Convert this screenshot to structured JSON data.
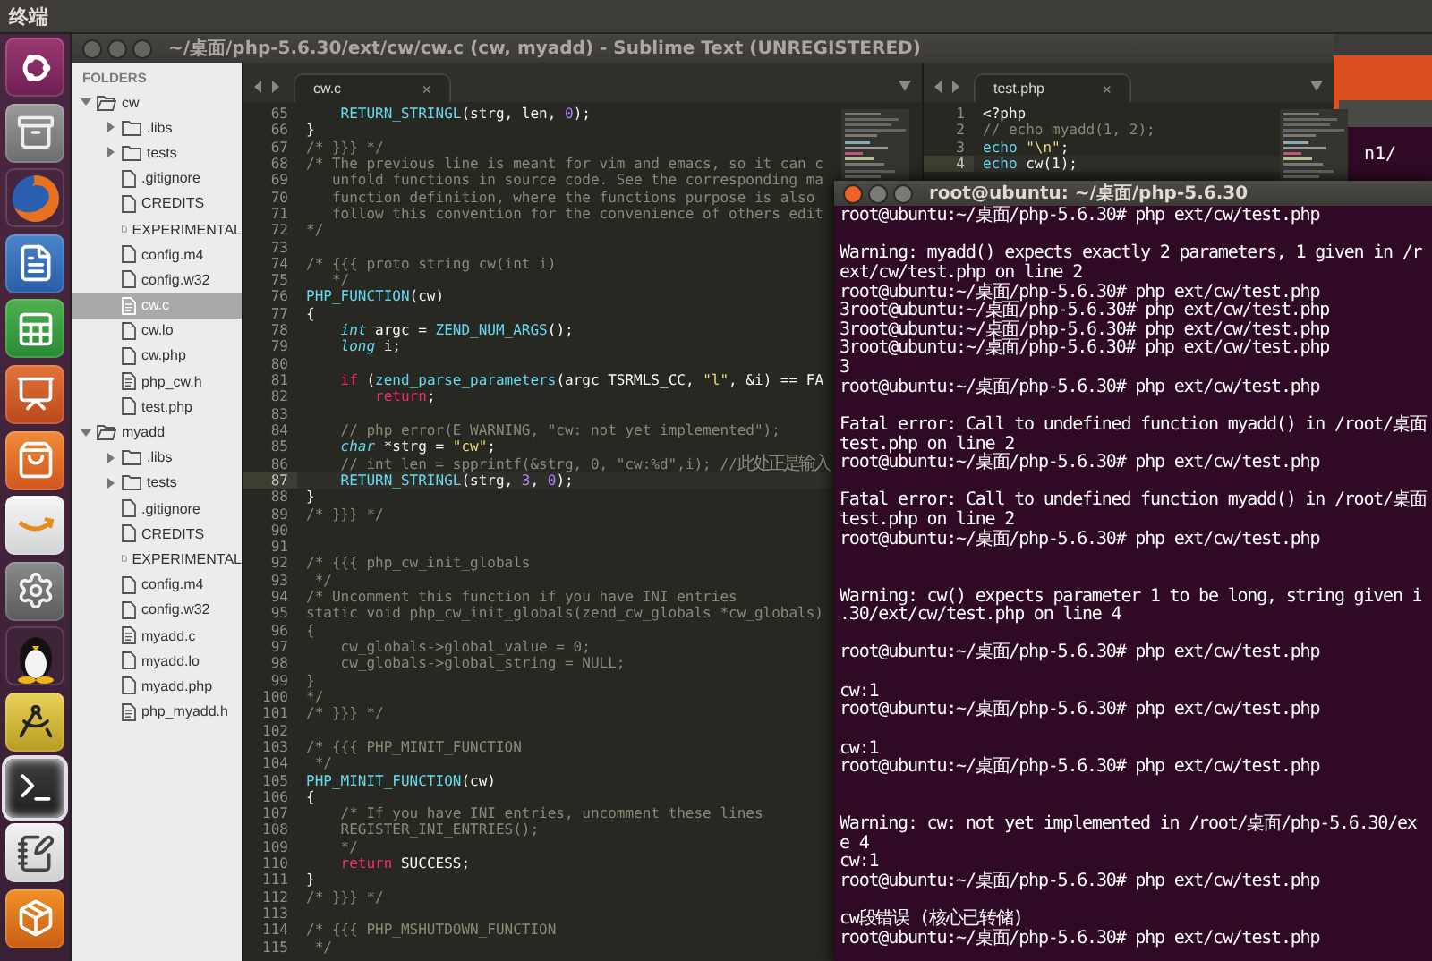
{
  "top_bar": {
    "title": "终端"
  },
  "launcher": {
    "items": [
      {
        "kind": "dash",
        "selected": false
      },
      {
        "kind": "files",
        "selected": false
      },
      {
        "kind": "browser",
        "selected": false
      },
      {
        "kind": "writer",
        "selected": false
      },
      {
        "kind": "calc",
        "selected": false
      },
      {
        "kind": "impress",
        "selected": false
      },
      {
        "kind": "store",
        "selected": false
      },
      {
        "kind": "amazon",
        "selected": false
      },
      {
        "kind": "settings",
        "selected": false
      },
      {
        "kind": "penguin",
        "selected": false
      },
      {
        "kind": "geometry",
        "selected": false
      },
      {
        "kind": "terminal",
        "selected": true
      },
      {
        "kind": "editor",
        "selected": false
      },
      {
        "kind": "box",
        "selected": false
      }
    ]
  },
  "editor": {
    "title": "~/桌面/php-5.6.30/ext/cw/cw.c (cw, myadd) - Sublime Text (UNREGISTERED)",
    "sidebar": {
      "heading": "FOLDERS",
      "tree": [
        {
          "label": "cw",
          "kind": "folder",
          "expanded": true,
          "selected": false,
          "children": [
            {
              "label": ".libs",
              "kind": "folder",
              "expanded": false,
              "selected": false
            },
            {
              "label": "tests",
              "kind": "folder",
              "expanded": false,
              "selected": false
            },
            {
              "label": ".gitignore",
              "kind": "file",
              "selected": false
            },
            {
              "label": "CREDITS",
              "kind": "file",
              "selected": false
            },
            {
              "label": "EXPERIMENTAL",
              "kind": "file",
              "selected": false
            },
            {
              "label": "config.m4",
              "kind": "file",
              "selected": false
            },
            {
              "label": "config.w32",
              "kind": "file",
              "selected": false
            },
            {
              "label": "cw.c",
              "kind": "source",
              "selected": true
            },
            {
              "label": "cw.lo",
              "kind": "file",
              "selected": false
            },
            {
              "label": "cw.php",
              "kind": "file",
              "selected": false
            },
            {
              "label": "php_cw.h",
              "kind": "source",
              "selected": false
            },
            {
              "label": "test.php",
              "kind": "file",
              "selected": false
            }
          ]
        },
        {
          "label": "myadd",
          "kind": "folder",
          "expanded": true,
          "selected": false,
          "children": [
            {
              "label": ".libs",
              "kind": "folder",
              "expanded": false,
              "selected": false
            },
            {
              "label": "tests",
              "kind": "folder",
              "expanded": false,
              "selected": false
            },
            {
              "label": ".gitignore",
              "kind": "file",
              "selected": false
            },
            {
              "label": "CREDITS",
              "kind": "file",
              "selected": false
            },
            {
              "label": "EXPERIMENTAL",
              "kind": "file",
              "selected": false
            },
            {
              "label": "config.m4",
              "kind": "file",
              "selected": false
            },
            {
              "label": "config.w32",
              "kind": "file",
              "selected": false
            },
            {
              "label": "myadd.c",
              "kind": "source",
              "selected": false
            },
            {
              "label": "myadd.lo",
              "kind": "file",
              "selected": false
            },
            {
              "label": "myadd.php",
              "kind": "file",
              "selected": false
            },
            {
              "label": "php_myadd.h",
              "kind": "source",
              "selected": false
            }
          ]
        }
      ]
    },
    "panes": [
      {
        "tabs": [
          {
            "label": "cw.c",
            "close": "×",
            "selected": true
          }
        ],
        "lines": [
          {
            "number": "65",
            "current": false,
            "tokens": [
              {
                "kind": "func",
                "text": "    RETURN_STRINGL"
              },
              {
                "kind": "plain",
                "text": "(strg, len, "
              },
              {
                "kind": "number",
                "text": "0"
              },
              {
                "kind": "plain",
                "text": ");"
              }
            ]
          },
          {
            "number": "66",
            "current": false,
            "tokens": [
              {
                "kind": "plain",
                "text": "}"
              }
            ]
          },
          {
            "number": "67",
            "current": false,
            "tokens": [
              {
                "kind": "comment",
                "text": "/* }}} */"
              }
            ]
          },
          {
            "number": "68",
            "current": false,
            "tokens": [
              {
                "kind": "comment",
                "text": "/* The previous line is meant for vim and emacs, so it can c"
              }
            ]
          },
          {
            "number": "69",
            "current": false,
            "tokens": [
              {
                "kind": "comment",
                "text": "   unfold functions in source code. See the corresponding ma"
              }
            ]
          },
          {
            "number": "70",
            "current": false,
            "tokens": [
              {
                "kind": "comment",
                "text": "   function definition, where the functions purpose is also"
              }
            ]
          },
          {
            "number": "71",
            "current": false,
            "tokens": [
              {
                "kind": "comment",
                "text": "   follow this convention for the convenience of others edit"
              }
            ]
          },
          {
            "number": "72",
            "current": false,
            "tokens": [
              {
                "kind": "comment",
                "text": "*/"
              }
            ]
          },
          {
            "number": "73",
            "current": false
          },
          {
            "number": "74",
            "current": false,
            "tokens": [
              {
                "kind": "comment",
                "text": "/* {{{ proto string cw(int i)"
              }
            ]
          },
          {
            "number": "75",
            "current": false,
            "tokens": [
              {
                "kind": "comment",
                "text": "   */"
              }
            ]
          },
          {
            "number": "76",
            "current": false,
            "tokens": [
              {
                "kind": "func",
                "text": "PHP_FUNCTION"
              },
              {
                "kind": "plain",
                "text": "(cw)"
              }
            ]
          },
          {
            "number": "77",
            "current": false,
            "tokens": [
              {
                "kind": "plain",
                "text": "{"
              }
            ]
          },
          {
            "number": "78",
            "current": false,
            "tokens": [
              {
                "kind": "type",
                "text": "    int"
              },
              {
                "kind": "plain",
                "text": " argc = "
              },
              {
                "kind": "func",
                "text": "ZEND_NUM_ARGS"
              },
              {
                "kind": "plain",
                "text": "();"
              }
            ]
          },
          {
            "number": "79",
            "current": false,
            "tokens": [
              {
                "kind": "type",
                "text": "    long"
              },
              {
                "kind": "plain",
                "text": " i;"
              }
            ]
          },
          {
            "number": "80",
            "current": false
          },
          {
            "number": "81",
            "current": false,
            "tokens": [
              {
                "kind": "keyword",
                "text": "    if"
              },
              {
                "kind": "plain",
                "text": " ("
              },
              {
                "kind": "func",
                "text": "zend_parse_parameters"
              },
              {
                "kind": "plain",
                "text": "(argc TSRMLS_CC, "
              },
              {
                "kind": "string",
                "text": "\"l\""
              },
              {
                "kind": "plain",
                "text": ", &i) == FA"
              }
            ]
          },
          {
            "number": "82",
            "current": false,
            "tokens": [
              {
                "kind": "keyword",
                "text": "        return"
              },
              {
                "kind": "plain",
                "text": ";"
              }
            ]
          },
          {
            "number": "83",
            "current": false
          },
          {
            "number": "84",
            "current": false,
            "tokens": [
              {
                "kind": "comment",
                "text": "    // php_error(E_WARNING, \"cw: not yet implemented\");"
              }
            ]
          },
          {
            "number": "85",
            "current": false,
            "tokens": [
              {
                "kind": "type",
                "text": "    char"
              },
              {
                "kind": "plain",
                "text": " *strg = "
              },
              {
                "kind": "string",
                "text": "\"cw\""
              },
              {
                "kind": "plain",
                "text": ";"
              }
            ]
          },
          {
            "number": "86",
            "current": false,
            "tokens": [
              {
                "kind": "comment",
                "text": "    // int len = spprintf(&strg, 0, \"cw:%d\",i); //"
              },
              {
                "kind": "wide",
                "text": "此处正是输入"
              }
            ]
          },
          {
            "number": "87",
            "current": true,
            "tokens": [
              {
                "kind": "func",
                "text": "    RETURN_STRINGL"
              },
              {
                "kind": "plain",
                "text": "(strg, "
              },
              {
                "kind": "number",
                "text": "3"
              },
              {
                "kind": "plain",
                "text": ", "
              },
              {
                "kind": "number",
                "text": "0"
              },
              {
                "kind": "plain",
                "text": ");"
              }
            ]
          },
          {
            "number": "88",
            "current": false,
            "tokens": [
              {
                "kind": "plain",
                "text": "}"
              }
            ]
          },
          {
            "number": "89",
            "current": false,
            "tokens": [
              {
                "kind": "comment",
                "text": "/* }}} */"
              }
            ]
          },
          {
            "number": "90",
            "current": false
          },
          {
            "number": "91",
            "current": false
          },
          {
            "number": "92",
            "current": false,
            "tokens": [
              {
                "kind": "comment",
                "text": "/* {{{ php_cw_init_globals"
              }
            ]
          },
          {
            "number": "93",
            "current": false,
            "tokens": [
              {
                "kind": "comment",
                "text": " */"
              }
            ]
          },
          {
            "number": "94",
            "current": false,
            "tokens": [
              {
                "kind": "comment",
                "text": "/* Uncomment this function if you have INI entries"
              }
            ]
          },
          {
            "number": "95",
            "current": false,
            "tokens": [
              {
                "kind": "comment",
                "text": "static void php_cw_init_globals(zend_cw_globals *cw_globals)"
              }
            ]
          },
          {
            "number": "96",
            "current": false,
            "tokens": [
              {
                "kind": "comment",
                "text": "{"
              }
            ]
          },
          {
            "number": "97",
            "current": false,
            "tokens": [
              {
                "kind": "comment",
                "text": "    cw_globals->global_value = 0;"
              }
            ]
          },
          {
            "number": "98",
            "current": false,
            "tokens": [
              {
                "kind": "comment",
                "text": "    cw_globals->global_string = NULL;"
              }
            ]
          },
          {
            "number": "99",
            "current": false,
            "tokens": [
              {
                "kind": "comment",
                "text": "}"
              }
            ]
          },
          {
            "number": "100",
            "current": false,
            "tokens": [
              {
                "kind": "comment",
                "text": "*/"
              }
            ]
          },
          {
            "number": "101",
            "current": false,
            "tokens": [
              {
                "kind": "comment",
                "text": "/* }}} */"
              }
            ]
          },
          {
            "number": "102",
            "current": false
          },
          {
            "number": "103",
            "current": false,
            "tokens": [
              {
                "kind": "comment",
                "text": "/* {{{ PHP_MINIT_FUNCTION"
              }
            ]
          },
          {
            "number": "104",
            "current": false,
            "tokens": [
              {
                "kind": "comment",
                "text": " */"
              }
            ]
          },
          {
            "number": "105",
            "current": false,
            "tokens": [
              {
                "kind": "func",
                "text": "PHP_MINIT_FUNCTION"
              },
              {
                "kind": "plain",
                "text": "(cw)"
              }
            ]
          },
          {
            "number": "106",
            "current": false,
            "tokens": [
              {
                "kind": "plain",
                "text": "{"
              }
            ]
          },
          {
            "number": "107",
            "current": false,
            "tokens": [
              {
                "kind": "comment",
                "text": "    /* If you have INI entries, uncomment these lines"
              }
            ]
          },
          {
            "number": "108",
            "current": false,
            "tokens": [
              {
                "kind": "comment",
                "text": "    REGISTER_INI_ENTRIES();"
              }
            ]
          },
          {
            "number": "109",
            "current": false,
            "tokens": [
              {
                "kind": "comment",
                "text": "    */"
              }
            ]
          },
          {
            "number": "110",
            "current": false,
            "tokens": [
              {
                "kind": "keyword",
                "text": "    return"
              },
              {
                "kind": "plain",
                "text": " SUCCESS;"
              }
            ]
          },
          {
            "number": "111",
            "current": false,
            "tokens": [
              {
                "kind": "plain",
                "text": "}"
              }
            ]
          },
          {
            "number": "112",
            "current": false,
            "tokens": [
              {
                "kind": "comment",
                "text": "/* }}} */"
              }
            ]
          },
          {
            "number": "113",
            "current": false
          },
          {
            "number": "114",
            "current": false,
            "tokens": [
              {
                "kind": "comment",
                "text": "/* {{{ PHP_MSHUTDOWN_FUNCTION"
              }
            ]
          },
          {
            "number": "115",
            "current": false,
            "tokens": [
              {
                "kind": "comment",
                "text": " */"
              }
            ]
          }
        ]
      },
      {
        "tabs": [
          {
            "label": "test.php",
            "close": "×",
            "selected": true
          }
        ],
        "lines": [
          {
            "number": "1",
            "current": false,
            "tokens": [
              {
                "kind": "plain",
                "text": "<?php"
              }
            ]
          },
          {
            "number": "2",
            "current": false,
            "tokens": [
              {
                "kind": "comment",
                "text": "// echo myadd(1, 2);"
              }
            ]
          },
          {
            "number": "3",
            "current": false,
            "tokens": [
              {
                "kind": "func",
                "text": "echo"
              },
              {
                "kind": "string",
                "text": " \"\\n\""
              },
              {
                "kind": "plain",
                "text": ";"
              }
            ]
          },
          {
            "number": "4",
            "current": true,
            "tokens": [
              {
                "kind": "func",
                "text": "echo"
              },
              {
                "kind": "plain",
                "text": " cw(1);"
              }
            ]
          }
        ]
      }
    ]
  },
  "background_window": {
    "lines": [
      "n1/"
    ]
  },
  "terminal": {
    "title": "root@ubuntu: ~/桌面/php-5.6.30",
    "lines": [
      {
        "text": "root@ubuntu:~/桌面/php-5.6.30# php ext/cw/test.php",
        "blank_before": false,
        "extra_blank": false
      },
      {
        "text": "Warning: myadd() expects exactly 2 parameters, 1 given in /r",
        "blank_before": true,
        "extra_blank": false
      },
      {
        "text": "ext/cw/test.php on line 2",
        "blank_before": false,
        "extra_blank": false
      },
      {
        "text": "root@ubuntu:~/桌面/php-5.6.30# php ext/cw/test.php",
        "blank_before": false,
        "extra_blank": false
      },
      {
        "text": "3root@ubuntu:~/桌面/php-5.6.30# php ext/cw/test.php",
        "blank_before": false,
        "extra_blank": false
      },
      {
        "text": "3root@ubuntu:~/桌面/php-5.6.30# php ext/cw/test.php",
        "blank_before": false,
        "extra_blank": false
      },
      {
        "text": "3root@ubuntu:~/桌面/php-5.6.30# php ext/cw/test.php",
        "blank_before": false,
        "extra_blank": false
      },
      {
        "text": "3",
        "blank_before": false,
        "extra_blank": false
      },
      {
        "text": "root@ubuntu:~/桌面/php-5.6.30# php ext/cw/test.php",
        "blank_before": false,
        "extra_blank": false
      },
      {
        "text": "Fatal error: Call to undefined function myadd() in /root/桌面",
        "blank_before": true,
        "extra_blank": false
      },
      {
        "text": "test.php on line 2",
        "blank_before": false,
        "extra_blank": false
      },
      {
        "text": "root@ubuntu:~/桌面/php-5.6.30# php ext/cw/test.php",
        "blank_before": false,
        "extra_blank": false
      },
      {
        "text": "Fatal error: Call to undefined function myadd() in /root/桌面",
        "blank_before": true,
        "extra_blank": false
      },
      {
        "text": "test.php on line 2",
        "blank_before": false,
        "extra_blank": false
      },
      {
        "text": "root@ubuntu:~/桌面/php-5.6.30# php ext/cw/test.php",
        "blank_before": false,
        "extra_blank": false
      },
      {
        "text": "Warning: cw() expects parameter 1 to be long, string given i",
        "blank_before": true,
        "extra_blank": true
      },
      {
        "text": ".30/ext/cw/test.php on line 4",
        "blank_before": false,
        "extra_blank": false
      },
      {
        "text": "root@ubuntu:~/桌面/php-5.6.30# php ext/cw/test.php",
        "blank_before": true,
        "extra_blank": false
      },
      {
        "text": "cw:1",
        "blank_before": true,
        "extra_blank": false
      },
      {
        "text": "root@ubuntu:~/桌面/php-5.6.30# php ext/cw/test.php",
        "blank_before": false,
        "extra_blank": false
      },
      {
        "text": "cw:1",
        "blank_before": true,
        "extra_blank": false
      },
      {
        "text": "root@ubuntu:~/桌面/php-5.6.30# php ext/cw/test.php",
        "blank_before": false,
        "extra_blank": false
      },
      {
        "text": "Warning: cw: not yet implemented in /root/桌面/php-5.6.30/ex",
        "blank_before": true,
        "extra_blank": true
      },
      {
        "text": "e 4",
        "blank_before": false,
        "extra_blank": false
      },
      {
        "text": "cw:1",
        "blank_before": false,
        "extra_blank": false
      },
      {
        "text": "root@ubuntu:~/桌面/php-5.6.30# php ext/cw/test.php",
        "blank_before": false,
        "extra_blank": false
      },
      {
        "text": "cw段错误 (核心已转储)",
        "blank_before": true,
        "extra_blank": false
      },
      {
        "text": "root@ubuntu:~/桌面/php-5.6.30# php ext/cw/test.php",
        "blank_before": false,
        "extra_blank": false
      }
    ]
  }
}
